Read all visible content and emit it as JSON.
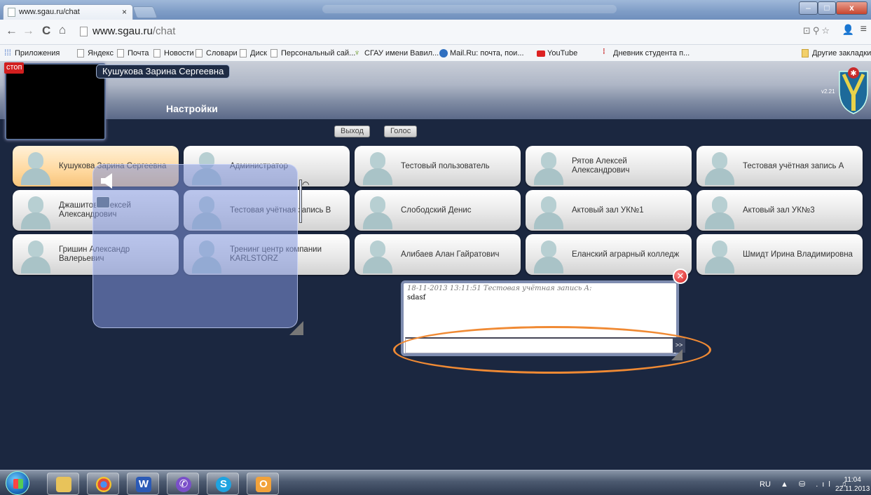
{
  "browser": {
    "tab_title": "www.sgau.ru/chat",
    "tab_close": "×",
    "url_host": "www.sgau.ru",
    "url_path": "/chat",
    "nav": {
      "back": "←",
      "forward": "→",
      "reload": "C",
      "home": "⌂"
    },
    "menu_icon": "≡",
    "omnibox_tools": "⊡⚲☆",
    "ext_icon": "👤",
    "window_controls": {
      "minimize": "–",
      "maximize": "□",
      "close": "x"
    }
  },
  "bookmarks": [
    {
      "label": "Приложения",
      "icon": "apps-icon"
    },
    {
      "label": "Яндекс",
      "icon": "page-icon"
    },
    {
      "label": "Почта",
      "icon": "page-icon"
    },
    {
      "label": "Новости",
      "icon": "page-icon"
    },
    {
      "label": "Словари",
      "icon": "page-icon"
    },
    {
      "label": "Диск",
      "icon": "page-icon"
    },
    {
      "label": "Персональный сай...",
      "icon": "page-icon"
    },
    {
      "label": "СГАУ имени Вавил...",
      "icon": "plant-icon"
    },
    {
      "label": "Mail.Ru: почта, пои...",
      "icon": "mail-icon"
    },
    {
      "label": "YouTube",
      "icon": "youtube-icon"
    },
    {
      "label": "Дневник студента п...",
      "icon": "diary-icon"
    },
    {
      "label": "Другие закладки",
      "icon": "folder-icon"
    }
  ],
  "app": {
    "stop_label": "стоп",
    "current_user": "Кушукова Зарина Сергеевна",
    "settings_title": "Настройки",
    "version": "v2.21",
    "exit_label": "Выход",
    "voice_label": "Голос",
    "contacts": [
      {
        "name": "Кушукова Зарина Сергеевна",
        "active": true
      },
      {
        "name": "Администратор",
        "active": false
      },
      {
        "name": "Тестовый пользователь",
        "active": false
      },
      {
        "name": "Рятов Алексей Александрович",
        "active": false
      },
      {
        "name": "Тестовая учётная запись А",
        "active": false
      },
      {
        "name": "Джашитов Алексей Александрович",
        "active": false
      },
      {
        "name": "Тестовая учётная запись В",
        "active": false
      },
      {
        "name": "Слободский Денис",
        "active": false
      },
      {
        "name": "Актовый зал УК№1",
        "active": false
      },
      {
        "name": "Актовый зал УК№3",
        "active": false
      },
      {
        "name": "Гришин Александр Валерьевич",
        "active": false
      },
      {
        "name": "Тренинг центр компании KARLSTORZ",
        "active": false
      },
      {
        "name": "Алибаев Алан Гайратович",
        "active": false
      },
      {
        "name": "Еланский аграрный колледж",
        "active": false
      },
      {
        "name": "Шмидт Ирина Владимировна",
        "active": false
      }
    ],
    "chat": {
      "message_meta": "18-11-2013 13:11:51 Тестовая учётная запись А:",
      "message_text": "sdasf",
      "input_value": "",
      "send_label": ">>",
      "close_label": "✕"
    }
  },
  "taskbar": {
    "apps": [
      "explorer",
      "chrome",
      "word",
      "viber",
      "skype",
      "outlook"
    ],
    "language": "RU",
    "tray_icons": "▲ ⛁ .ıl ♫",
    "time": "11:04",
    "date": "22.11.2013"
  },
  "colors": {
    "app_background": "#1b2740",
    "active_card": "#ffd9a0",
    "highlight": "#f08a34",
    "stop_button": "#d21f1f"
  }
}
